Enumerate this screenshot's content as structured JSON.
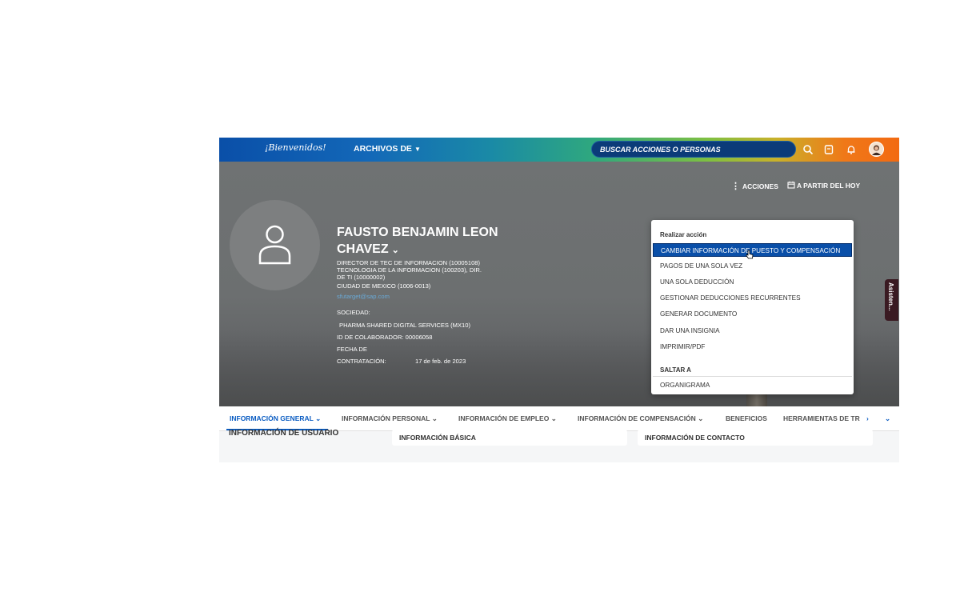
{
  "topbar": {
    "logo": "¡Bienvenidos!",
    "archivos": "ARCHIVOS DE",
    "search_placeholder": "BUSCAR ACCIONES O PERSONAS",
    "icons": [
      "search-icon",
      "notes-icon",
      "bell-icon",
      "user-avatar"
    ]
  },
  "header": {
    "actions_label": "ACCIONES",
    "as_of_label": "A PARTIR DEL HOY",
    "employee": {
      "name_line1": "FAUSTO BENJAMIN LEON",
      "name_line2": "CHAVEZ",
      "position": "DIRECTOR DE TEC DE INFORMACION (10005108)",
      "department_line1": "TECNOLOGIA DE LA INFORMACION (100203), DIR.",
      "department_line2": "DE TI (10000002)",
      "location": "CIUDAD DE MEXICO (1006-0013)",
      "email": "sfutarget@sap.com",
      "company_label": "SOCIEDAD:",
      "company_value": "PHARMA SHARED DIGITAL SERVICES (MX10)",
      "id_label": "ID DE COLABORADOR:",
      "id_value": "00006058",
      "hire_label_line1": "FECHA DE",
      "hire_label_line2": "CONTRATACIÓN:",
      "hire_value": "17 de feb. de 2023"
    }
  },
  "actions_menu": {
    "heading": "Realizar acción",
    "items": [
      "CAMBIAR INFORMACIÓN DE PUESTO Y COMPENSACIÓN",
      "PAGOS DE UNA SOLA VEZ",
      "UNA SOLA DEDUCCIÓN",
      "GESTIONAR DEDUCCIONES RECURRENTES",
      "GENERAR DOCUMENTO",
      "DAR UNA INSIGNIA",
      "IMPRIMIR/PDF"
    ],
    "jump_heading": "SALTAR A",
    "jump_items": [
      "ORGANIGRAMA"
    ]
  },
  "side_tab": "Asisten...",
  "tabs": [
    "INFORMACIÓN GENERAL",
    "INFORMACIÓN PERSONAL",
    "INFORMACIÓN DE EMPLEO",
    "INFORMACIÓN DE COMPENSACIÓN",
    "BENEFICIOS",
    "HERRAMIENTAS DE TR"
  ],
  "content": {
    "section_title": "INFORMACIÓN DE USUARIO",
    "card1_title": "INFORMACIÓN BÁSICA",
    "card2_title": "INFORMACIÓN DE CONTACTO"
  },
  "colors": {
    "brand_blue": "#0a4fa8",
    "active_tab": "#0a5cc2",
    "accent_orange": "#f26a12"
  }
}
